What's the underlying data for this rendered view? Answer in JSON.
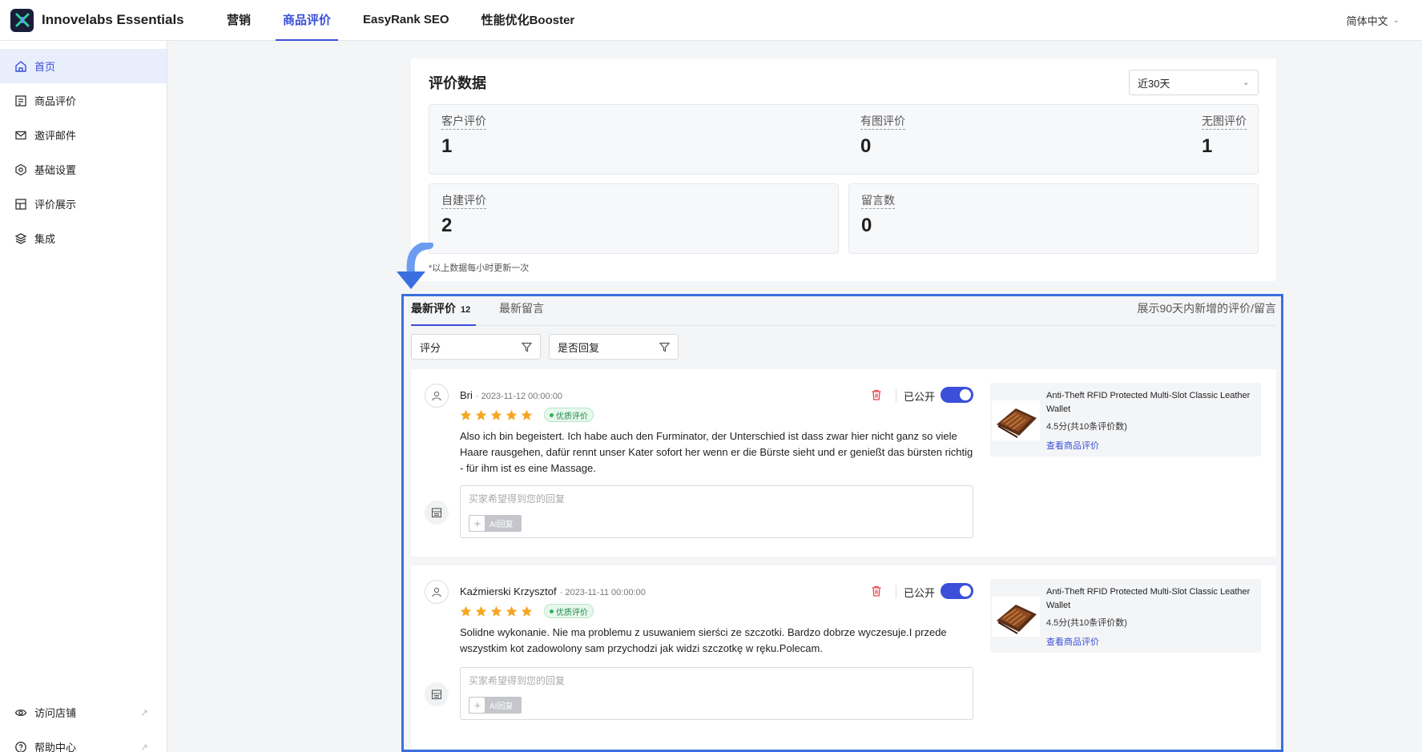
{
  "app": {
    "title": "Innovelabs Essentials",
    "language": "简体中文"
  },
  "nav": {
    "items": [
      "营销",
      "商品评价",
      "EasyRank SEO",
      "性能优化Booster"
    ],
    "active": "商品评价"
  },
  "sidebar": {
    "items": [
      {
        "label": "首页",
        "icon": "home-icon",
        "active": true
      },
      {
        "label": "商品评价",
        "icon": "review-list-icon",
        "active": false
      },
      {
        "label": "邀评邮件",
        "icon": "mail-icon",
        "active": false
      },
      {
        "label": "基础设置",
        "icon": "settings-icon",
        "active": false
      },
      {
        "label": "评价展示",
        "icon": "layout-icon",
        "active": false
      },
      {
        "label": "集成",
        "icon": "layers-icon",
        "active": false
      }
    ],
    "bottom": [
      {
        "label": "访问店铺",
        "icon": "eye-icon"
      },
      {
        "label": "帮助中心",
        "icon": "help-icon"
      }
    ]
  },
  "stats": {
    "title": "评价数据",
    "range": "近30天",
    "customer_reviews": {
      "label": "客户评价",
      "value": "1"
    },
    "with_image": {
      "label": "有图评价",
      "value": "0"
    },
    "without_image": {
      "label": "无图评价",
      "value": "1"
    },
    "self_created": {
      "label": "自建评价",
      "value": "2"
    },
    "comments": {
      "label": "留言数",
      "value": "0"
    },
    "note": "*以上数据每小时更新一次"
  },
  "reviews_panel": {
    "tab_latest": "最新评价",
    "tab_latest_count": "12",
    "tab_comments": "最新留言",
    "hint": "展示90天内新增的评价/留言",
    "filter_rating": "评分",
    "filter_replied": "是否回复"
  },
  "reviews": [
    {
      "name": "Bri",
      "date": "· 2023-11-12 00:00:00",
      "rating": 5,
      "badge": "优质评价",
      "text": "Also ich bin begeistert. Ich habe auch den Furminator, der Unterschied ist dass zwar hier nicht ganz so viele Haare rausgehen, dafür rennt unser Kater sofort her wenn er die Bürste sieht und er genießt das bürsten richtig - für ihm ist es eine Massage.",
      "public_label": "已公开",
      "reply_placeholder": "买家希望得到您的回复",
      "ai_label": "AI回复",
      "product": {
        "name": "Anti-Theft RFID Protected Multi-Slot Classic Leather Wallet",
        "score": "4.5分(共10条评价数)",
        "link": "查看商品评价"
      }
    },
    {
      "name": "Kaźmierski Krzysztof",
      "date": "· 2023-11-11 00:00:00",
      "rating": 5,
      "badge": "优质评价",
      "text": "Solidne wykonanie. Nie ma problemu z usuwaniem sierści ze szczotki. Bardzo dobrze wyczesuje.I przede wszystkim kot zadowolony sam przychodzi jak widzi szczotkę w ręku.Polecam.",
      "public_label": "已公开",
      "reply_placeholder": "买家希望得到您的回复",
      "ai_label": "AI回复",
      "product": {
        "name": "Anti-Theft RFID Protected Multi-Slot Classic Leather Wallet",
        "score": "4.5分(共10条评价数)",
        "link": "查看商品评价"
      }
    }
  ],
  "colors": {
    "accent": "#3b4fd8",
    "highlight": "#3b6fe0",
    "star": "#f5a623",
    "danger": "#e5484d"
  }
}
